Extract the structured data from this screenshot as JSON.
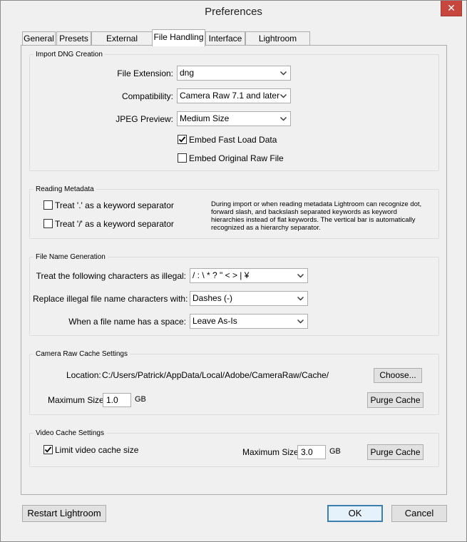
{
  "window": {
    "title": "Preferences",
    "close_glyph": "✕"
  },
  "tabs": [
    {
      "label": "General"
    },
    {
      "label": "Presets"
    },
    {
      "label": "External Editing"
    },
    {
      "label": "File Handling",
      "active": true
    },
    {
      "label": "Interface"
    },
    {
      "label": "Lightroom mobile"
    }
  ],
  "import_dng": {
    "legend": "Import DNG Creation",
    "file_extension": {
      "label": "File Extension:",
      "value": "dng"
    },
    "compatibility": {
      "label": "Compatibility:",
      "value": "Camera Raw 7.1 and later"
    },
    "jpeg_preview": {
      "label": "JPEG Preview:",
      "value": "Medium Size"
    },
    "embed_fast_load": {
      "label": "Embed Fast Load Data",
      "checked": true
    },
    "embed_original_raw": {
      "label": "Embed Original Raw File",
      "checked": false
    }
  },
  "reading_metadata": {
    "legend": "Reading Metadata",
    "dot_separator": {
      "label": "Treat '.' as a keyword separator",
      "checked": false
    },
    "slash_separator": {
      "label": "Treat '/' as a keyword separator",
      "checked": false
    },
    "note": "During import or when reading metadata Lightroom can recognize dot, forward slash, and backslash separated keywords as keyword hierarchies instead of flat keywords. The vertical bar is automatically recognized as a hierarchy separator."
  },
  "file_name_generation": {
    "legend": "File Name Generation",
    "illegal_chars": {
      "label": "Treat the following characters as illegal:",
      "value": "/ : \\ * ? \" < > | ¥"
    },
    "replace_with": {
      "label": "Replace illegal file name characters with:",
      "value": "Dashes (-)"
    },
    "space_handling": {
      "label": "When a file name has a space:",
      "value": "Leave As-Is"
    }
  },
  "camera_raw_cache": {
    "legend": "Camera Raw Cache Settings",
    "location_label": "Location:",
    "location_value": "C:/Users/Patrick/AppData/Local/Adobe/CameraRaw/Cache/",
    "choose_button": "Choose...",
    "max_size_label": "Maximum Size:",
    "max_size_value": "1.0",
    "max_size_unit": "GB",
    "purge_button": "Purge Cache"
  },
  "video_cache": {
    "legend": "Video Cache Settings",
    "limit": {
      "label": "Limit video cache size",
      "checked": true
    },
    "max_size_label": "Maximum Size:",
    "max_size_value": "3.0",
    "max_size_unit": "GB",
    "purge_button": "Purge Cache"
  },
  "footer": {
    "restart_button": "Restart Lightroom",
    "ok_button": "OK",
    "cancel_button": "Cancel"
  }
}
